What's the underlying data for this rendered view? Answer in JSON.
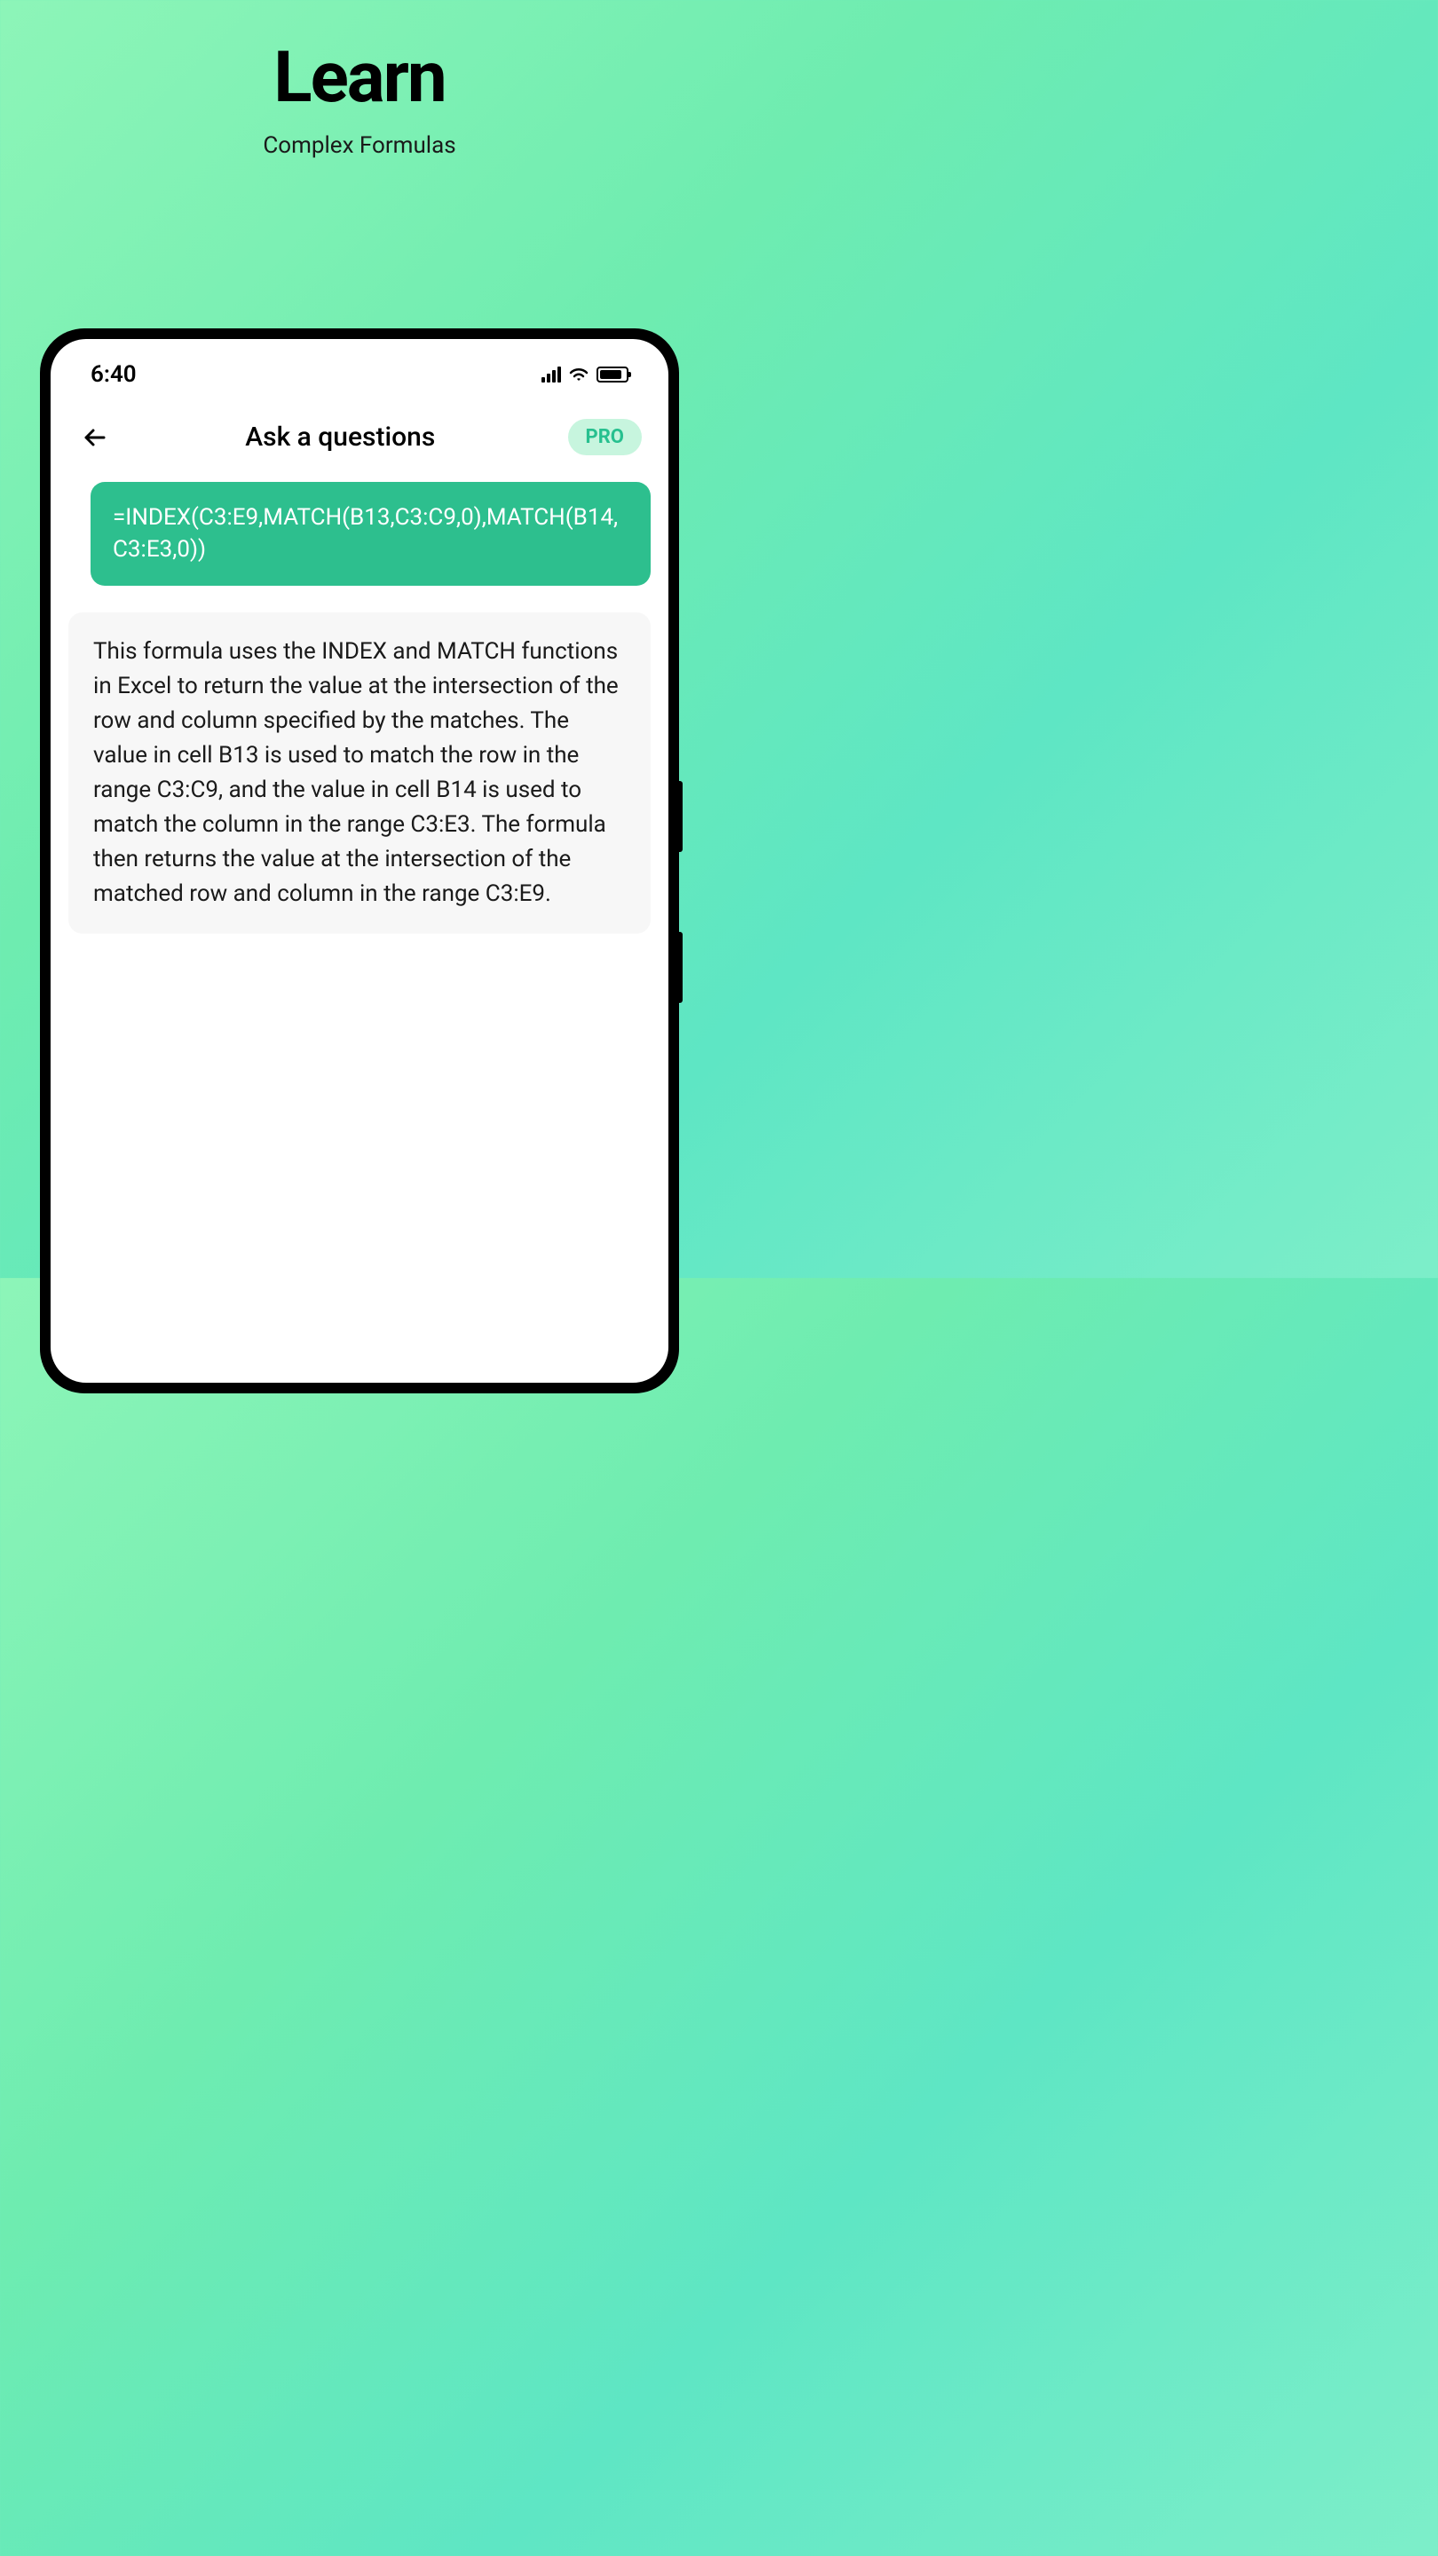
{
  "hero": {
    "title": "Learn",
    "subtitle": "Complex Formulas"
  },
  "statusBar": {
    "time": "6:40"
  },
  "header": {
    "title": "Ask a questions",
    "badge": "PRO"
  },
  "chat": {
    "userMessage": "=INDEX(C3:E9,MATCH(B13,C3:C9,0),MATCH(B14,C3:E3,0))",
    "assistantMessage": "This formula uses the INDEX and MATCH functions in Excel to return the value at the intersection of the row and column specified by the matches. The value in cell B13 is used to match the row in the range C3:C9, and the value in cell B14 is used to match the column in the range C3:E3. The formula then returns the value at the intersection of the matched row and column in the range C3:E9."
  }
}
